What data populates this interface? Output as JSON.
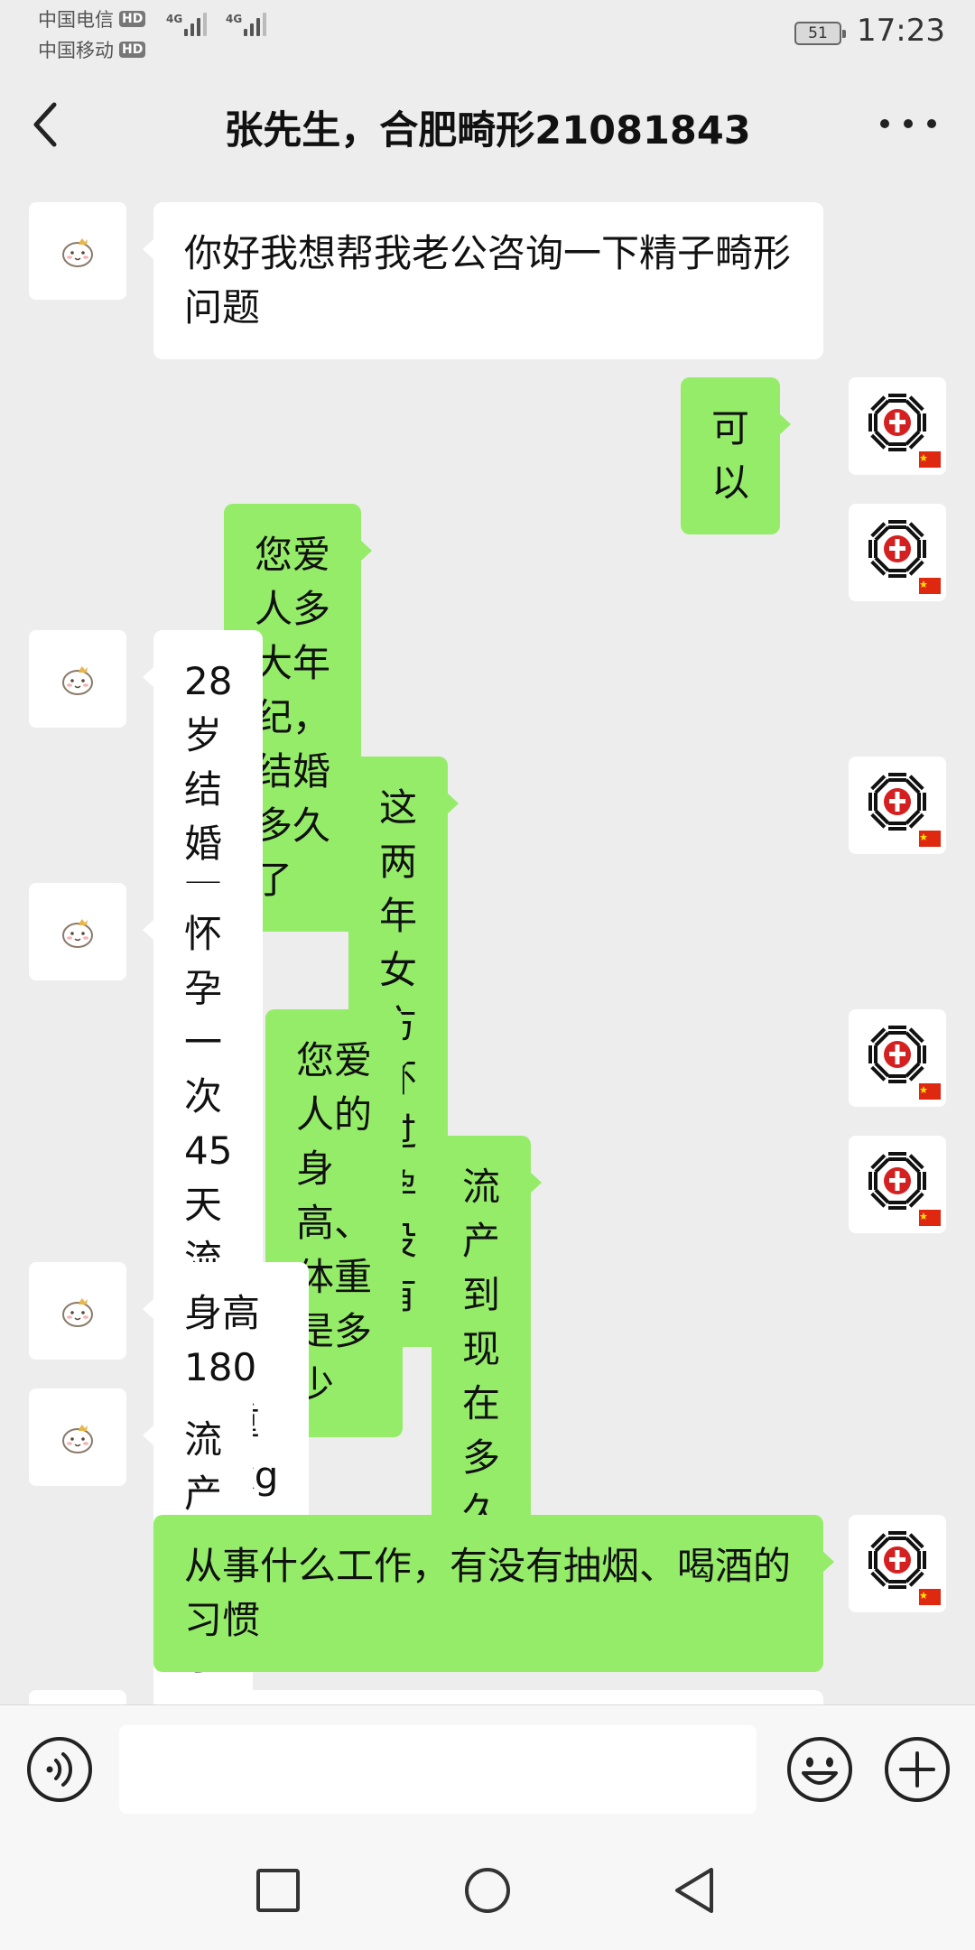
{
  "status_bar": {
    "carriers": [
      {
        "name": "中国电信",
        "badge": "HD"
      },
      {
        "name": "中国移动",
        "badge": "HD"
      }
    ],
    "network_type": "4G",
    "battery": "51",
    "time": "17:23"
  },
  "header": {
    "title": "张先生，合肥畸形21081843",
    "back_icon": "chevron-left-icon",
    "more_icon": "more-horizontal-icon"
  },
  "messages": [
    {
      "from": "contact",
      "text": "你好我想帮我老公咨询一下精子畸形问题"
    },
    {
      "from": "me",
      "text": "可以"
    },
    {
      "from": "me",
      "text": "您爱人多大年纪，结婚多久了"
    },
    {
      "from": "contact",
      "text": "28 岁 结婚两年"
    },
    {
      "from": "me",
      "text": "这两年女方怀过孕没有"
    },
    {
      "from": "contact",
      "text": "怀孕一次 45 天流产"
    },
    {
      "from": "me",
      "text": "您爱人的身高、体重是多少"
    },
    {
      "from": "me",
      "text": "流产到现在多久了"
    },
    {
      "from": "contact",
      "text": "身高 180 体重 68kg"
    },
    {
      "from": "contact",
      "text": "流产一年了"
    },
    {
      "from": "me",
      "text": "从事什么工作，有没有抽烟、喝酒的习惯"
    }
  ],
  "input_bar": {
    "voice_icon": "voice-icon",
    "input_value": "",
    "emoji_icon": "emoji-icon",
    "add_icon": "plus-circle-icon"
  },
  "nav_bar": {
    "icons": [
      "square-recent-icon",
      "circle-home-icon",
      "triangle-back-icon"
    ]
  },
  "colors": {
    "background": "#ededed",
    "bubble_in": "#ffffff",
    "bubble_out": "#95ec69",
    "text": "#111111"
  }
}
